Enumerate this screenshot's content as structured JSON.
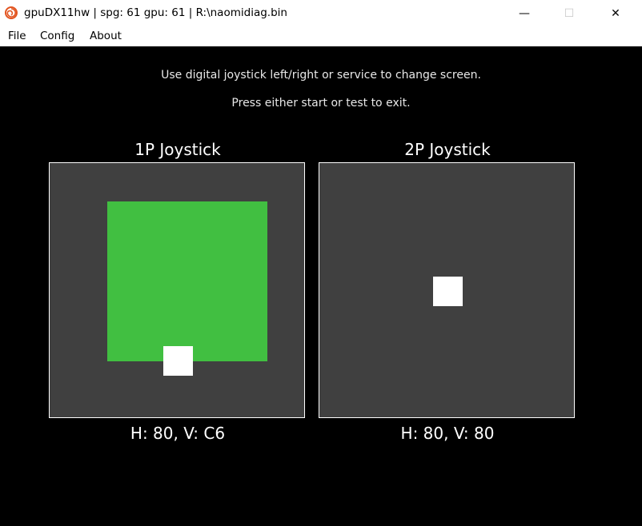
{
  "window": {
    "title": "gpuDX11hw | spg: 61 gpu: 61 | R:\\naomidiag.bin",
    "app_icon": "dreamcast-swirl-icon",
    "controls": {
      "minimize": "—",
      "maximize": "☐",
      "close": "✕"
    }
  },
  "menu": {
    "items": [
      "File",
      "Config",
      "About"
    ]
  },
  "screen": {
    "instruction_1": "Use digital joystick left/right or service to change screen.",
    "instruction_2": "Press either start or test to exit."
  },
  "joysticks": [
    {
      "title": "1P Joystick",
      "readout": "H: 80, V: C6",
      "active": true
    },
    {
      "title": "2P Joystick",
      "readout": "H: 80, V: 80",
      "active": false
    }
  ],
  "colors": {
    "panel_bg": "#404040",
    "active_fill": "#41bf41",
    "marker": "#ffffff",
    "background": "#000000"
  }
}
